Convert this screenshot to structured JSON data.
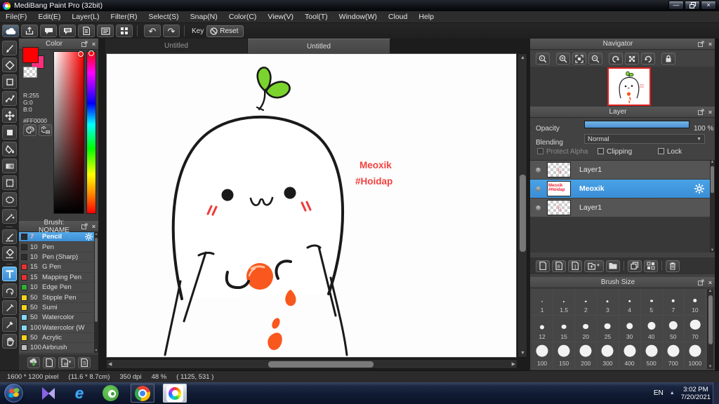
{
  "window": {
    "title": "MediBang Paint Pro (32bit)"
  },
  "menu": {
    "items": [
      "File(F)",
      "Edit(E)",
      "Layer(L)",
      "Filter(R)",
      "Select(S)",
      "Snap(N)",
      "Color(C)",
      "View(V)",
      "Tool(T)",
      "Window(W)",
      "Cloud",
      "Help"
    ]
  },
  "toolbar": {
    "key_label": "Key",
    "reset_label": "Reset"
  },
  "color_panel": {
    "title": "Color",
    "r": "R:255",
    "g": "G:0",
    "b": "B:0",
    "hex": "#FF0000",
    "primary_color": "#ff0000",
    "secondary_color": "#ff2e7d"
  },
  "brush_panel": {
    "title": "Brush: NONAME",
    "brushes": [
      {
        "size": "7",
        "name": "Pencil",
        "swatch": "#2c2c2c",
        "selected": true
      },
      {
        "size": "10",
        "name": "Pen",
        "swatch": "#2c2c2c",
        "selected": false
      },
      {
        "size": "10",
        "name": "Pen (Sharp)",
        "swatch": "#2c2c2c",
        "selected": false
      },
      {
        "size": "15",
        "name": "G Pen",
        "swatch": "#e93030",
        "selected": false
      },
      {
        "size": "15",
        "name": "Mapping Pen",
        "swatch": "#e93030",
        "selected": false
      },
      {
        "size": "10",
        "name": "Edge Pen",
        "swatch": "#2fae36",
        "selected": false
      },
      {
        "size": "50",
        "name": "Stipple Pen",
        "swatch": "#f3d31d",
        "selected": false
      },
      {
        "size": "50",
        "name": "Sumi",
        "swatch": "#f3d31d",
        "selected": false
      },
      {
        "size": "50",
        "name": "Watercolor",
        "swatch": "#86d9f5",
        "selected": false
      },
      {
        "size": "100",
        "name": "Watercolor (W",
        "swatch": "#86d9f5",
        "selected": false
      },
      {
        "size": "50",
        "name": "Acrylic",
        "swatch": "#f3d31d",
        "selected": false
      },
      {
        "size": "100",
        "name": "Airbrush",
        "swatch": "#bfbfbf",
        "selected": false
      }
    ]
  },
  "canvas": {
    "tabs": [
      {
        "label": "Untitled",
        "active": false
      },
      {
        "label": "Untitled",
        "active": true
      }
    ],
    "annotation_line1": "Meoxik",
    "annotation_line2": "#Hoidap",
    "annotation_color": "#f2413e"
  },
  "navigator": {
    "title": "Navigator"
  },
  "layer_panel": {
    "title": "Layer",
    "opacity_label": "Opacity",
    "opacity_value": "100 %",
    "blending_label": "Blending",
    "blending_value": "Normal",
    "protect_alpha_label": "Protect Alpha",
    "clipping_label": "Clipping",
    "lock_label": "Lock",
    "layers": [
      {
        "name": "Layer1",
        "selected": false,
        "thumb_text": ""
      },
      {
        "name": "Meoxik",
        "selected": true,
        "thumb_text": "Meoxik #Hoidap"
      },
      {
        "name": "Layer1",
        "selected": false,
        "thumb_text": ""
      }
    ]
  },
  "brush_size_panel": {
    "title": "Brush Size",
    "sizes": [
      "1",
      "1.5",
      "2",
      "3",
      "4",
      "5",
      "7",
      "10",
      "12",
      "15",
      "20",
      "25",
      "30",
      "40",
      "50",
      "70",
      "100",
      "150",
      "200",
      "300",
      "400",
      "500",
      "700",
      "1000"
    ]
  },
  "statusbar": {
    "dimensions": "1600 * 1200 pixel",
    "size_cm": "(11.6 * 8.7cm)",
    "dpi": "350 dpi",
    "zoom": "48 %",
    "coords": "( 1125, 531 )"
  },
  "taskbar": {
    "lang": "EN",
    "time": "3:02 PM",
    "date": "7/20/2021"
  }
}
